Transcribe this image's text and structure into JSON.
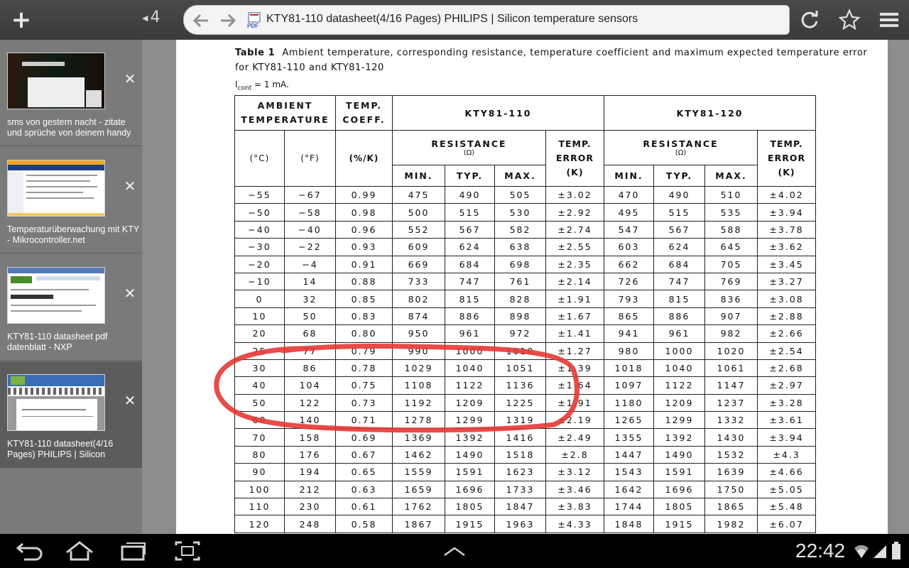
{
  "browser": {
    "tab_count": "4",
    "page_title": "KTY81-110 datasheet(4/16 Pages) PHILIPS | Silicon temperature sensors",
    "accent": "#e53935"
  },
  "tabs": [
    {
      "label": "sms von gestern nacht - zitate und sprüche von deinem handy"
    },
    {
      "label": "Temperaturüberwachung mit KTY - Mikrocontroller.net"
    },
    {
      "label": "KTY81-110 datasheet pdf datenblatt - NXP"
    },
    {
      "label": "KTY81-110 datasheet(4/16 Pages) PHILIPS | Silicon"
    }
  ],
  "document": {
    "table_label": "Table 1",
    "caption": "Ambient temperature, corresponding resistance, temperature coefficient and maximum expected temperature error for KTY81-110 and KTY81-120",
    "icont_symbol": "I",
    "icont_sub": "cont",
    "icont_value": " = 1 mA.",
    "headers": {
      "ambient": "AMBIENT TEMPERATURE",
      "coeff": "TEMP. COEFF.",
      "kty110": "KTY81-110",
      "kty120": "KTY81-120",
      "resistance": "RESISTANCE",
      "ohm": "(Ω)",
      "error": "TEMP. ERROR (K)",
      "degc": "(°C)",
      "degf": "(°F)",
      "pct": "(%/K)",
      "min": "MIN.",
      "typ": "TYP.",
      "max": "MAX."
    },
    "rows": [
      [
        "−55",
        "−67",
        "0.99",
        "475",
        "490",
        "505",
        "±3.02",
        "470",
        "490",
        "510",
        "±4.02"
      ],
      [
        "−50",
        "−58",
        "0.98",
        "500",
        "515",
        "530",
        "±2.92",
        "495",
        "515",
        "535",
        "±3.94"
      ],
      [
        "−40",
        "−40",
        "0.96",
        "552",
        "567",
        "582",
        "±2.74",
        "547",
        "567",
        "588",
        "±3.78"
      ],
      [
        "−30",
        "−22",
        "0.93",
        "609",
        "624",
        "638",
        "±2.55",
        "603",
        "624",
        "645",
        "±3.62"
      ],
      [
        "−20",
        "−4",
        "0.91",
        "669",
        "684",
        "698",
        "±2.35",
        "662",
        "684",
        "705",
        "±3.45"
      ],
      [
        "−10",
        "14",
        "0.88",
        "733",
        "747",
        "761",
        "±2.14",
        "726",
        "747",
        "769",
        "±3.27"
      ],
      [
        "0",
        "32",
        "0.85",
        "802",
        "815",
        "828",
        "±1.91",
        "793",
        "815",
        "836",
        "±3.08"
      ],
      [
        "10",
        "50",
        "0.83",
        "874",
        "886",
        "898",
        "±1.67",
        "865",
        "886",
        "907",
        "±2.88"
      ],
      [
        "20",
        "68",
        "0.80",
        "950",
        "961",
        "972",
        "±1.41",
        "941",
        "961",
        "982",
        "±2.66"
      ],
      [
        "25",
        "77",
        "0.79",
        "990",
        "1000",
        "1010",
        "±1.27",
        "980",
        "1000",
        "1020",
        "±2.54"
      ],
      [
        "30",
        "86",
        "0.78",
        "1029",
        "1040",
        "1051",
        "±1.39",
        "1018",
        "1040",
        "1061",
        "±2.68"
      ],
      [
        "40",
        "104",
        "0.75",
        "1108",
        "1122",
        "1136",
        "±1.64",
        "1097",
        "1122",
        "1147",
        "±2.97"
      ],
      [
        "50",
        "122",
        "0.73",
        "1192",
        "1209",
        "1225",
        "±1.91",
        "1180",
        "1209",
        "1237",
        "±3.28"
      ],
      [
        "60",
        "140",
        "0.71",
        "1278",
        "1299",
        "1319",
        "±2.19",
        "1265",
        "1299",
        "1332",
        "±3.61"
      ],
      [
        "70",
        "158",
        "0.69",
        "1369",
        "1392",
        "1416",
        "±2.49",
        "1355",
        "1392",
        "1430",
        "±3.94"
      ],
      [
        "80",
        "176",
        "0.67",
        "1462",
        "1490",
        "1518",
        "±2.8",
        "1447",
        "1490",
        "1532",
        "±4.3"
      ],
      [
        "90",
        "194",
        "0.65",
        "1559",
        "1591",
        "1623",
        "±3.12",
        "1543",
        "1591",
        "1639",
        "±4.66"
      ],
      [
        "100",
        "212",
        "0.63",
        "1659",
        "1696",
        "1733",
        "±3.46",
        "1642",
        "1696",
        "1750",
        "±5.05"
      ],
      [
        "110",
        "230",
        "0.61",
        "1762",
        "1805",
        "1847",
        "±3.83",
        "1744",
        "1805",
        "1865",
        "±5.48"
      ],
      [
        "120",
        "248",
        "0.58",
        "1867",
        "1915",
        "1963",
        "±4.33",
        "1848",
        "1915",
        "1982",
        "±6.07"
      ]
    ]
  },
  "status": {
    "time": "22:42"
  }
}
